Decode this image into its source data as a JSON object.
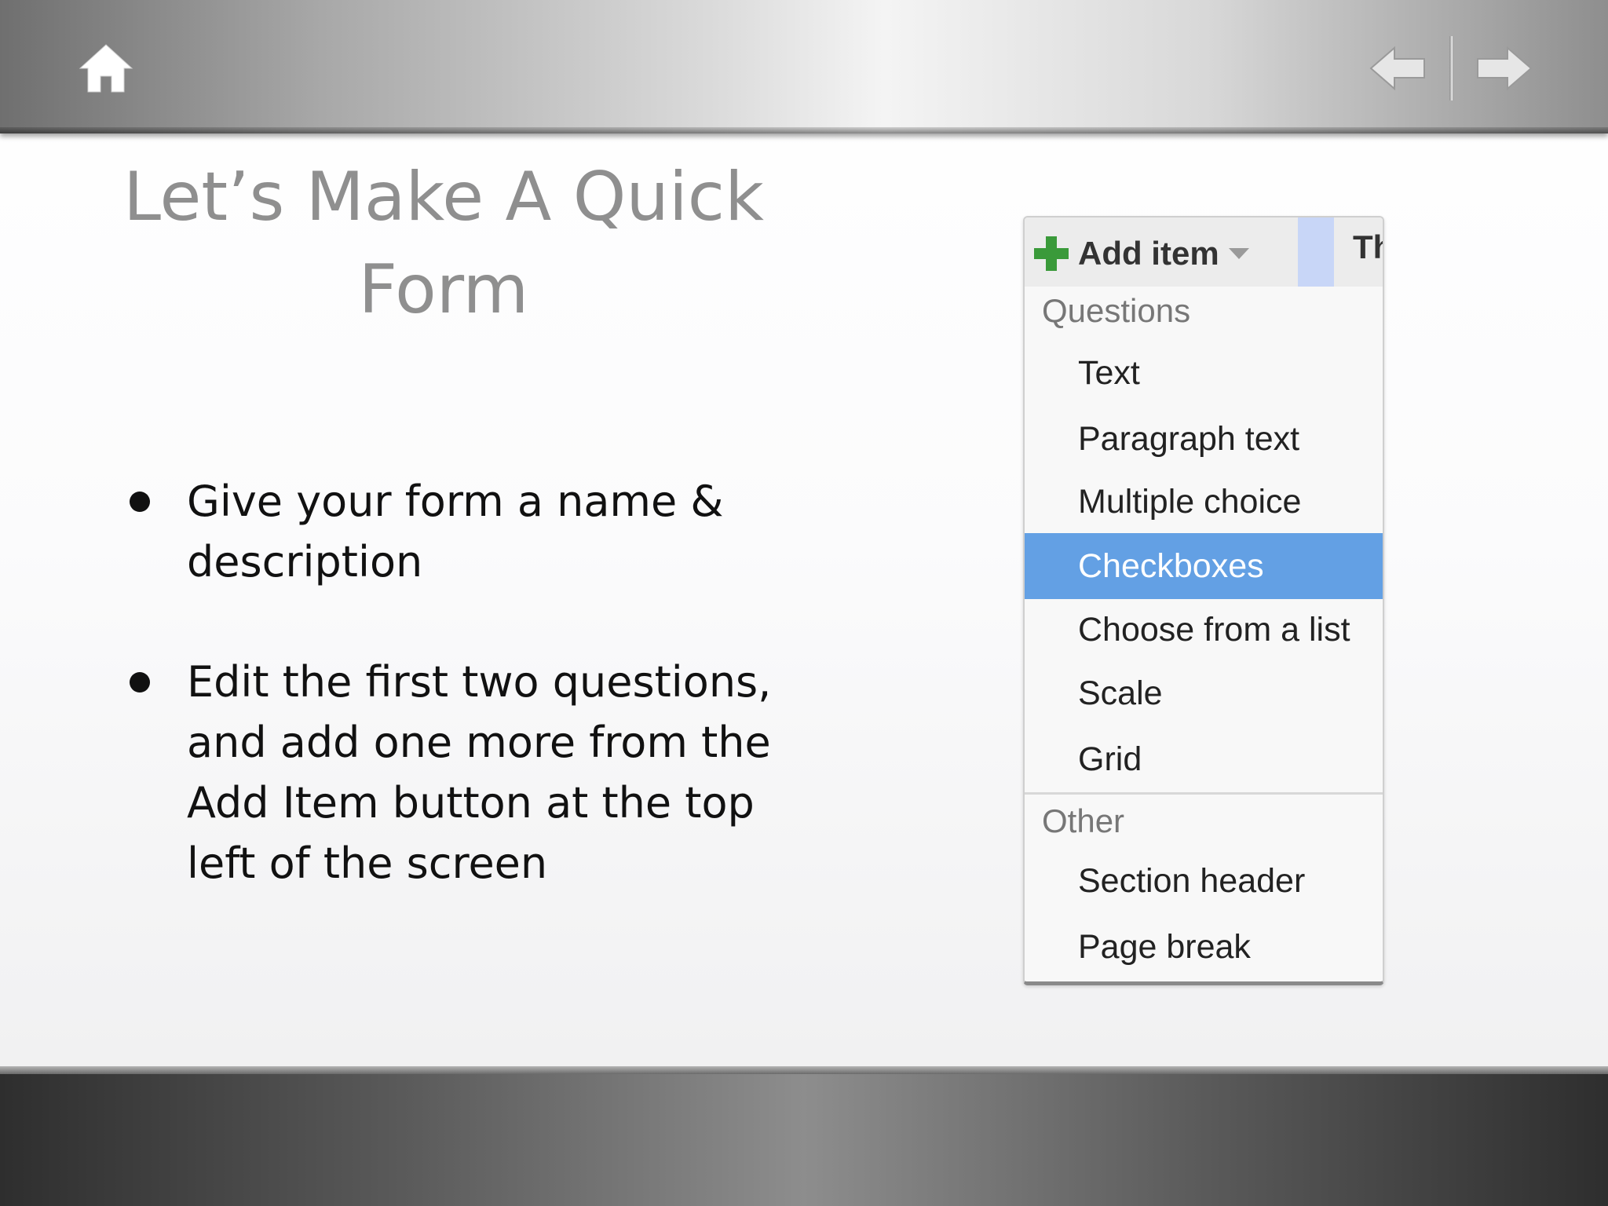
{
  "slide": {
    "title_line1": "Let’s Make A Quick",
    "title_line2": "Form",
    "bullets": [
      {
        "line1": "Give your form a name &",
        "line2": "description"
      },
      {
        "line1": "Edit the first two questions,",
        "line2": "and add one more from the",
        "line3": "Add Item button at the top",
        "line4": "left of the screen"
      }
    ]
  },
  "toolbar": {
    "home_icon": "home-icon",
    "prev_icon": "arrow-left-icon",
    "next_icon": "arrow-right-icon"
  },
  "menu": {
    "add_item_label": "Add item",
    "next_tab_label": "Th",
    "questions_heading": "Questions",
    "question_items": [
      "Text",
      "Paragraph text",
      "Multiple choice",
      "Checkboxes",
      "Choose from a list",
      "Scale",
      "Grid"
    ],
    "selected_item": "Checkboxes",
    "other_heading": "Other",
    "other_items": [
      "Section header",
      "Page break"
    ]
  },
  "colors": {
    "title": "#8f8f8f",
    "selection": "#63a0e4",
    "plus_icon": "#3a9a3a",
    "tab_highlight": "#c8d6f7"
  }
}
